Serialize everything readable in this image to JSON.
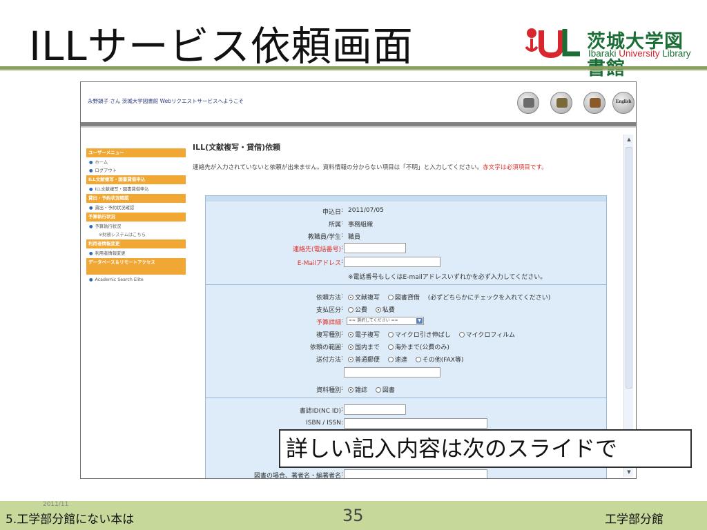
{
  "slide": {
    "title": "ILLサービス依頼画面",
    "logo": {
      "jp": "茨城大学図書館",
      "en_part1": "Ibaraki ",
      "en_part2": "University",
      "en_part3": " Library"
    },
    "callout": "詳しい記入内容は次のスライドで",
    "footer": {
      "left": "5.工学部分館にない本は",
      "date": "2011/11",
      "page": "35",
      "right": "工学部分館"
    }
  },
  "app": {
    "welcome": "永野鍋子 さん 茨城大学図書館 Webリクエストサービスへようこそ",
    "header_icons": [
      "book-icon",
      "home-icon",
      "house-roof-icon"
    ],
    "english_button": "English",
    "sidebar": [
      {
        "type": "head",
        "label": "ユーザーメニュー"
      },
      {
        "type": "item",
        "label": "ホーム"
      },
      {
        "type": "item",
        "label": "ログアウト"
      },
      {
        "type": "head",
        "label": "ILL文献複写・図書貸借申込"
      },
      {
        "type": "item",
        "label": "ILL文献複写・図書貸借申込"
      },
      {
        "type": "head",
        "label": "貸出・予約状況確認"
      },
      {
        "type": "item",
        "label": "貸出・予約状況確認"
      },
      {
        "type": "head",
        "label": "予算執行状況"
      },
      {
        "type": "item",
        "label": "予算執行状況"
      },
      {
        "type": "plain",
        "label": "※財務システムはこちら"
      },
      {
        "type": "head",
        "label": "利用者情報変更"
      },
      {
        "type": "item",
        "label": "利用者情報変更"
      },
      {
        "type": "headtall",
        "label": "データベース＆リモートアクセス"
      },
      {
        "type": "item",
        "label": "Academic Search Elite"
      }
    ],
    "page_heading": "ILL(文献複写・貸借)依頼",
    "notice_main": "連絡先が入力されていないと依頼が出来ません。資料情報の分からない項目は「不明」と入力してください。",
    "notice_required": "赤文字は必須項目です。",
    "form": {
      "apply_date_label": "申込日",
      "apply_date": "2011/07/05",
      "affiliation_label": "所属",
      "affiliation": "事務組織",
      "status_label": "教職員/学生",
      "status": "職員",
      "phone_label": "連絡先(電話番号)",
      "phone_value": "",
      "email_label": "E-Mailアドレス",
      "email_value": "",
      "contact_note": "※電話番号もしくはE-mailアドレスいずれかを必ず入力してください。",
      "method_label": "依頼方法",
      "method_options": [
        "文献複写",
        "図書貸借"
      ],
      "method_note": "(必ずどちらかにチェックを入れてください)",
      "payment_label": "支払区分",
      "payment_options": [
        "公費",
        "私費"
      ],
      "budget_label": "予算詳細",
      "budget_select": "== 選択してください ==",
      "copy_type_label": "複写種別",
      "copy_type_options": [
        "電子複写",
        "マイクロ引き伸ばし",
        "マイクロフィルム"
      ],
      "scope_label": "依頼の範囲",
      "scope_options": [
        "国内まで",
        "海外まで(公費のみ)"
      ],
      "delivery_label": "送付方法",
      "delivery_options": [
        "普通郵便",
        "速達",
        "その他(FAX等)"
      ],
      "material_label": "資料種別",
      "material_options": [
        "雑誌",
        "図書"
      ],
      "journal_id_label": "書誌ID(NC ID)",
      "isbn_label": "ISBN / ISSN",
      "book_author_label": "図書の場合、著者名・編著者名"
    }
  }
}
